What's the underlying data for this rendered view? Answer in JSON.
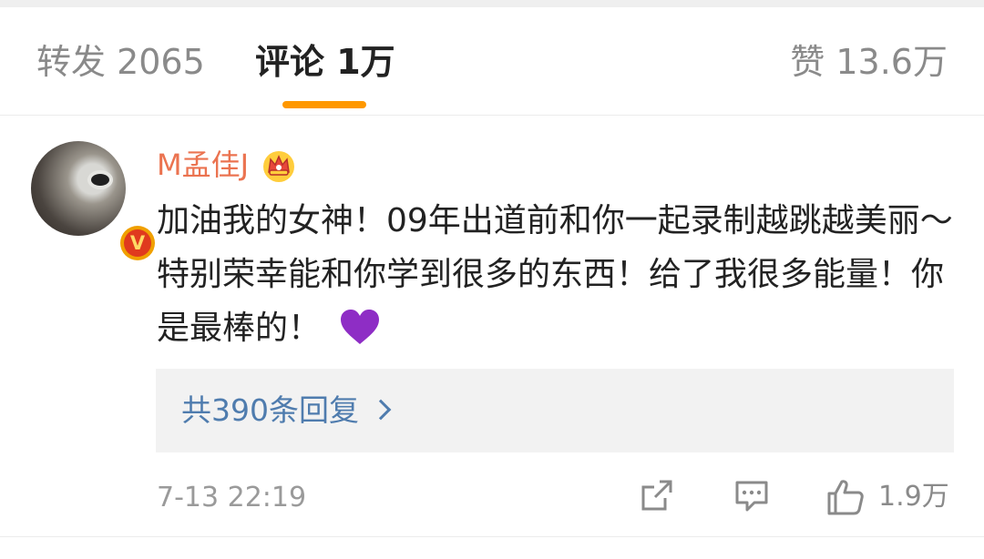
{
  "tabs": {
    "forward_label": "转发 2065",
    "comments_label": "评论 1万",
    "likes_label": "赞 13.6万",
    "indicator_color": "#ff9800"
  },
  "comment": {
    "username": "M孟佳J",
    "username_color": "#eb7350",
    "user_badge_icon": "crown-icon",
    "avatar_badge": "V",
    "text": "加油我的女神！09年出道前和你一起录制越跳越美丽～特别荣幸能和你学到很多的东西！给了我很多能量！你是最棒的！",
    "emoji_icon": "purple-heart-icon",
    "replies_label": "共390条回复",
    "timestamp": "7-13 22:19",
    "like_count": "1.9万"
  }
}
